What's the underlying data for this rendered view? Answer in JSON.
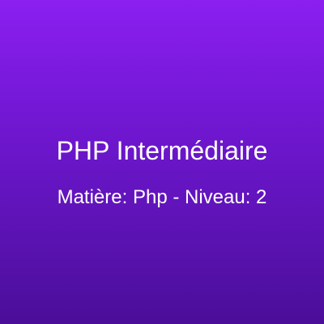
{
  "card": {
    "title": "PHP Intermédiaire",
    "subtitle": "Matière: Php - Niveau: 2"
  },
  "colors": {
    "gradient_top": "#8b1ff0",
    "gradient_bottom": "#4a0e99",
    "text": "#ffffff"
  }
}
